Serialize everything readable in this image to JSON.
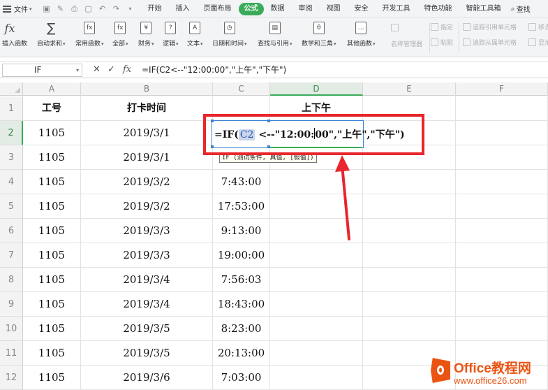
{
  "menubar": {
    "file_label": "文件",
    "tabs": [
      "开始",
      "插入",
      "页面布局",
      "公式",
      "数据",
      "审阅",
      "视图",
      "安全",
      "开发工具",
      "特色功能",
      "智能工具箱"
    ],
    "active_tab": "公式",
    "search_label": "查找"
  },
  "ribbon": {
    "buttons": [
      {
        "label": "插入函数",
        "icon": "fx-icon",
        "glyph": "fx"
      },
      {
        "label": "自动求和",
        "icon": "sigma-icon",
        "glyph": "∑"
      },
      {
        "label": "常用函数",
        "icon": "common-function-icon",
        "glyph": "fx"
      },
      {
        "label": "全部",
        "icon": "all-functions-icon",
        "glyph": "fx"
      },
      {
        "label": "财务",
        "icon": "finance-icon",
        "glyph": "¥"
      },
      {
        "label": "逻辑",
        "icon": "logic-icon",
        "glyph": "?"
      },
      {
        "label": "文本",
        "icon": "text-icon",
        "glyph": "A"
      },
      {
        "label": "日期和时间",
        "icon": "datetime-icon",
        "glyph": "◷"
      },
      {
        "label": "查找与引用",
        "icon": "lookup-icon",
        "glyph": "▤"
      },
      {
        "label": "数学和三角",
        "icon": "math-icon",
        "glyph": "θ"
      },
      {
        "label": "其他函数",
        "icon": "more-functions-icon",
        "glyph": "…"
      }
    ],
    "name_manager": "名称管理器",
    "specify": "指定",
    "paste": "粘贴",
    "trace_precedents": "追踪引用单元格",
    "trace_dependents": "追踪从属单元格",
    "remove_arrows": "移去",
    "show": "显示"
  },
  "formula_bar": {
    "name_box": "IF",
    "formula": "=IF(C2<--\"12:00:00\",\"上午\",\"下午\")"
  },
  "grid": {
    "columns": [
      "A",
      "B",
      "C",
      "D",
      "E",
      "F"
    ],
    "rows": [
      "1",
      "2",
      "3",
      "4",
      "5",
      "6",
      "7",
      "8",
      "9",
      "10",
      "11",
      "12"
    ],
    "header_row": [
      "工号",
      "打卡时间",
      "",
      "上下午"
    ],
    "data": [
      [
        "1105",
        "2019/3/1",
        "",
        ""
      ],
      [
        "1105",
        "2019/3/1",
        "",
        ""
      ],
      [
        "1105",
        "2019/3/2",
        "7:43:00",
        ""
      ],
      [
        "1105",
        "2019/3/2",
        "17:53:00",
        ""
      ],
      [
        "1105",
        "2019/3/3",
        "9:13:00",
        ""
      ],
      [
        "1105",
        "2019/3/3",
        "19:00:00",
        ""
      ],
      [
        "1105",
        "2019/3/4",
        "7:56:03",
        ""
      ],
      [
        "1105",
        "2019/3/4",
        "18:43:00",
        ""
      ],
      [
        "1105",
        "2019/3/5",
        "8:23:00",
        ""
      ],
      [
        "1105",
        "2019/3/5",
        "20:13:00",
        ""
      ],
      [
        "1105",
        "2019/3/6",
        "7:03:00",
        ""
      ]
    ]
  },
  "editor": {
    "prefix": "=IF(",
    "ref": "C2",
    "part1": " <--\"12:00:",
    "part2": "00\",\"上午\",\"下午\")",
    "tooltip": "IF (测试条件, 真值, [假值])"
  },
  "watermark": {
    "brand": "Office教程网",
    "url": "www.office26.com"
  },
  "colors": {
    "accent": "#3bab5a",
    "highlight": "#e8262c",
    "watermark": "#ea5413"
  }
}
